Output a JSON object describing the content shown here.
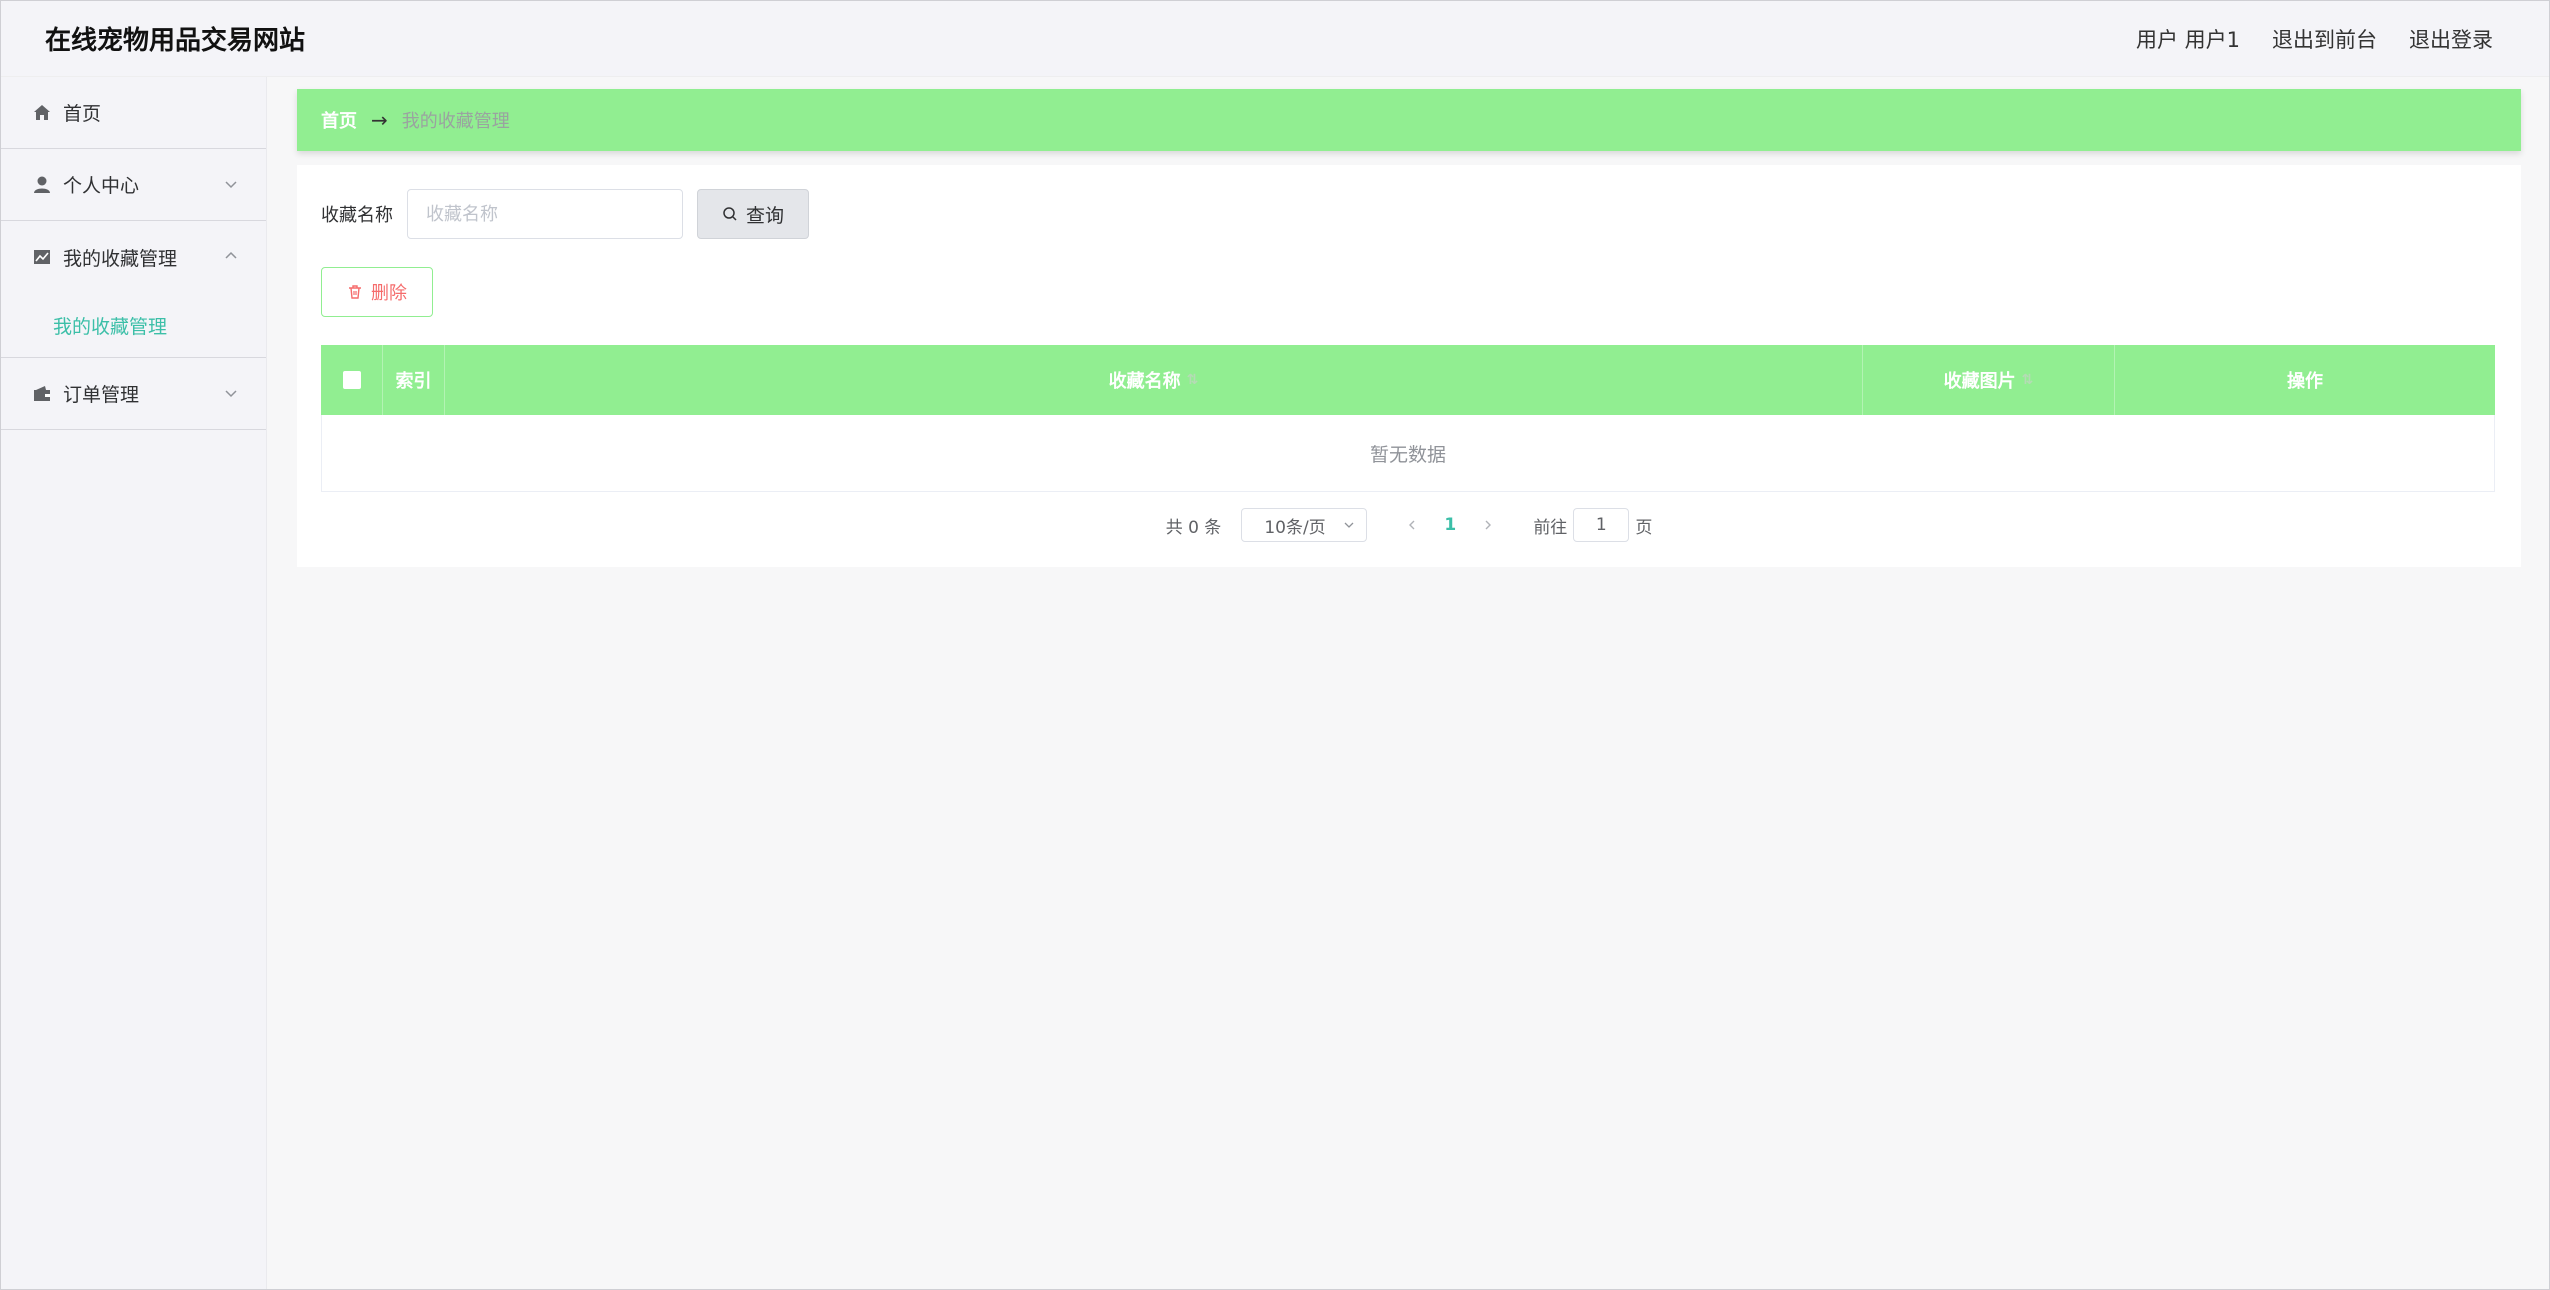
{
  "header": {
    "title": "在线宠物用品交易网站",
    "user_label": "用户 用户1",
    "to_front": "退出到前台",
    "logout": "退出登录"
  },
  "sidebar": {
    "items": [
      {
        "label": "首页",
        "icon": "home-icon"
      },
      {
        "label": "个人中心",
        "icon": "user-icon"
      },
      {
        "label": "我的收藏管理",
        "icon": "chart-icon",
        "expanded": true,
        "children": [
          {
            "label": "我的收藏管理"
          }
        ]
      },
      {
        "label": "订单管理",
        "icon": "wallet-icon"
      }
    ]
  },
  "breadcrumb": {
    "home": "首页",
    "separator": "→",
    "current": "我的收藏管理"
  },
  "search": {
    "label": "收藏名称",
    "placeholder": "收藏名称",
    "button": "查询"
  },
  "actions": {
    "delete": "删除"
  },
  "table": {
    "columns": [
      "",
      "索引",
      "收藏名称",
      "收藏图片",
      "操作"
    ],
    "empty_text": "暂无数据"
  },
  "pagination": {
    "total": "共 0 条",
    "page_size": "10条/页",
    "current_page": "1",
    "goto_prefix": "前往",
    "goto_value": "1",
    "goto_suffix": "页"
  },
  "colors": {
    "accent_green": "#91ee91",
    "active_text": "#3cbfa8",
    "danger": "#f56c6c"
  }
}
